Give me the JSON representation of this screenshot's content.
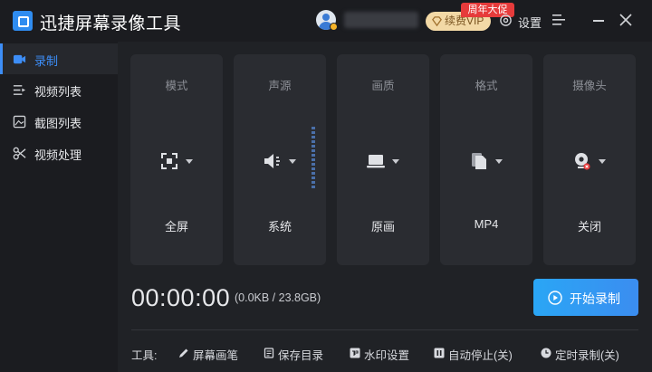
{
  "app": {
    "title": "迅捷屏幕录像工具"
  },
  "header": {
    "vip_label": "续费VIP",
    "promo_tag": "周年大促",
    "settings_label": "设置"
  },
  "sidebar": {
    "items": [
      {
        "label": "录制",
        "icon": "record-icon",
        "active": true
      },
      {
        "label": "视频列表",
        "icon": "video-list-icon",
        "active": false
      },
      {
        "label": "截图列表",
        "icon": "screenshot-list-icon",
        "active": false
      },
      {
        "label": "视频处理",
        "icon": "video-process-icon",
        "active": false
      }
    ]
  },
  "settings_cards": [
    {
      "title": "模式",
      "value": "全屏",
      "icon": "fullscreen-icon"
    },
    {
      "title": "声源",
      "value": "系统",
      "icon": "speaker-icon"
    },
    {
      "title": "画质",
      "value": "原画",
      "icon": "laptop-icon"
    },
    {
      "title": "格式",
      "value": "MP4",
      "icon": "file-format-icon"
    },
    {
      "title": "摄像头",
      "value": "关闭",
      "icon": "webcam-icon"
    }
  ],
  "recording": {
    "timer": "00:00:00",
    "size_info": "(0.0KB / 23.8GB)",
    "start_label": "开始录制"
  },
  "tools": {
    "label": "工具:",
    "items": [
      {
        "label": "屏幕画笔",
        "icon": "pen-icon"
      },
      {
        "label": "保存目录",
        "icon": "folder-icon"
      },
      {
        "label": "水印设置",
        "icon": "watermark-icon"
      },
      {
        "label": "自动停止(关)",
        "icon": "auto-stop-icon"
      },
      {
        "label": "定时录制(关)",
        "icon": "clock-icon"
      }
    ]
  },
  "colors": {
    "accent": "#3d8ef8",
    "vip_bg": "#f3d9a6",
    "promo_red": "#e63b3b",
    "start_button": "#2aa6f5"
  }
}
